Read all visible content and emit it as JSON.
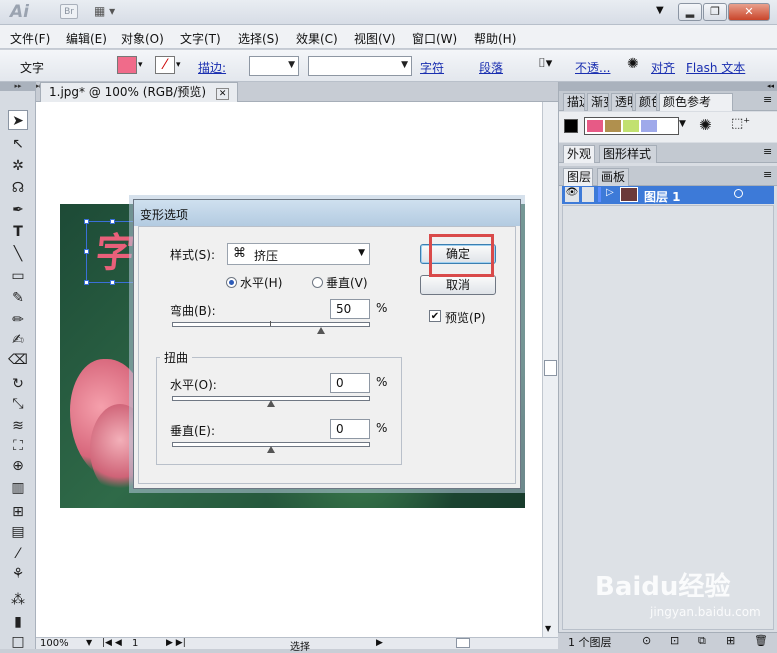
{
  "app": {
    "logo": "Ai",
    "bridge_label": "Br",
    "workspace_icon": "grid-icon"
  },
  "window_buttons": {
    "minimize": "▂",
    "restore": "❐",
    "close": "✕"
  },
  "menu": [
    "文件(F)",
    "编辑(E)",
    "对象(O)",
    "文字(T)",
    "选择(S)",
    "效果(C)",
    "视图(V)",
    "窗口(W)",
    "帮助(H)"
  ],
  "control": {
    "mode_label": "文字",
    "fill_color": "#f06b8a",
    "stroke_label": "描边:",
    "char_link": "字符",
    "para_link": "段落",
    "opacity_link": "不透...",
    "align_link": "对齐",
    "flash_link": "Flash 文本"
  },
  "document": {
    "tab_title": "1.jpg* @ 100% (RGB/预览)",
    "zoom": "100%",
    "page": "1",
    "status": "选择"
  },
  "textart": {
    "glyph": "字",
    "color": "#e9607a"
  },
  "dialog": {
    "title": "变形选项",
    "style_label": "样式(S):",
    "style_value": "挤压",
    "horizontal_radio": "水平(H)",
    "vertical_radio": "垂直(V)",
    "bend_label": "弯曲(B):",
    "bend_value": "50",
    "percent": "%",
    "distort_group": "扭曲",
    "distort_h_label": "水平(O):",
    "distort_h_value": "0",
    "distort_v_label": "垂直(E):",
    "distort_v_value": "0",
    "ok": "确定",
    "cancel": "取消",
    "preview": "预览(P)",
    "preview_checked": true,
    "bend_fraction": 0.75,
    "distort_h_fraction": 0.5,
    "distort_v_fraction": 0.5
  },
  "panels": {
    "top_tabs": [
      "描边",
      "渐变",
      "透明",
      "颜色",
      "颜色参考"
    ],
    "swatches": [
      "#000000",
      "#e75a86",
      "#b0904e",
      "#c2e170",
      "#9fa9ea"
    ],
    "appearance_tabs": [
      "外观",
      "图形样式"
    ],
    "layer_tabs": [
      "图层",
      "画板"
    ],
    "layer_name": "图层 1",
    "layer_count": "1 个图层"
  },
  "watermark": {
    "text": "Baidu经验",
    "sub": "jingyan.baidu.com"
  }
}
